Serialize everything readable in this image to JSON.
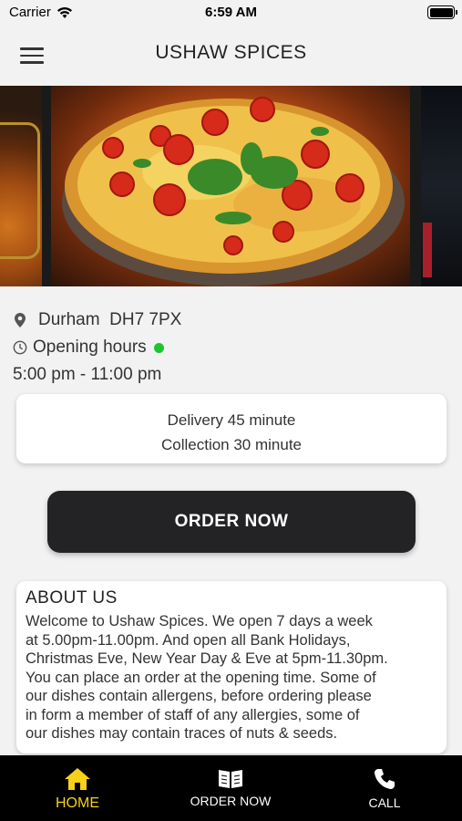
{
  "status_bar": {
    "carrier": "Carrier",
    "time": "6:59 AM"
  },
  "header": {
    "title": "USHAW SPICES"
  },
  "location": {
    "text": "Durham  DH7 7PX",
    "icon": "map-pin-icon"
  },
  "opening": {
    "label": "Opening hours",
    "hours": "5:00 pm - 11:00 pm",
    "status_color": "#1fc32e"
  },
  "delivery": {
    "line1": "Delivery 45 minute",
    "line2": "Collection 30 minute"
  },
  "order_button": {
    "label": "ORDER NOW"
  },
  "about": {
    "title": "ABOUT US",
    "lines": [
      "Welcome to Ushaw Spices. We open 7 days a week",
      "at 5.00pm-11.00pm. And  open all Bank Holidays,",
      "Christmas Eve, New Year Day & Eve at 5pm-11.30pm.",
      "You can place an order at the opening time. Some of",
      "our dishes contain allergens, before ordering please",
      "in form a member of staff of any allergies, some of",
      "our dishes may contain traces of nuts & seeds."
    ]
  },
  "tabs": [
    {
      "label": "HOME",
      "icon": "home-icon",
      "active": true
    },
    {
      "label": "ORDER NOW",
      "icon": "menu-book-icon",
      "active": false
    },
    {
      "label": "CALL",
      "icon": "phone-icon",
      "active": false
    }
  ],
  "colors": {
    "accent": "#f5d11a",
    "button": "#232225",
    "tab_bar": "#000000",
    "open": "#1fc32e"
  }
}
